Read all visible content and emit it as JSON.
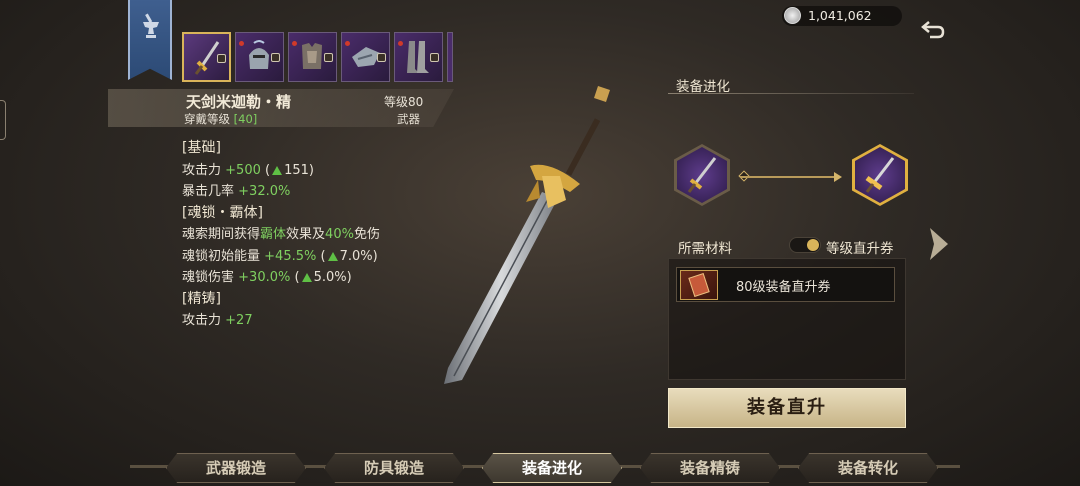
{
  "currency": {
    "icon": "silver-coin-icon",
    "value": "1,041,062"
  },
  "item": {
    "name": "天剑米迦勒・精",
    "level": "等级80",
    "wear_label": "穿戴等级",
    "wear_level": "[40]",
    "type": "武器"
  },
  "stats": {
    "base_header": "[基础]",
    "attack_label": "攻击力",
    "attack_value": "+500",
    "attack_open": "(",
    "attack_up": "151",
    "attack_close": ")",
    "crit_label": "暴击几率",
    "crit_value": "+32.0%",
    "soul_header": "[魂锁・霸体]",
    "soul_desc_a": "魂索期间获得",
    "soul_desc_b": "霸体",
    "soul_desc_c": "效果及",
    "soul_desc_d": "40%",
    "soul_desc_e": "免伤",
    "energy_label": "魂锁初始能量",
    "energy_value": "+45.5%",
    "energy_open": "(",
    "energy_up": "7.0%",
    "energy_close": ")",
    "dmg_label": "魂锁伤害",
    "dmg_value": "+30.0%",
    "dmg_open": "(",
    "dmg_up": "5.0%",
    "dmg_close": ")",
    "refine_header": "[精铸]",
    "refine_label": "攻击力",
    "refine_value": "+27"
  },
  "evolution": {
    "title": "装备进化",
    "materials_label": "所需材料",
    "toggle_label": "等级直升券",
    "material_item": "80级装备直升券",
    "upgrade_button": "装备直升"
  },
  "tabs": [
    {
      "label": "武器锻造"
    },
    {
      "label": "防具锻造"
    },
    {
      "label": "装备进化"
    },
    {
      "label": "装备精铸"
    },
    {
      "label": "装备转化"
    }
  ],
  "active_tab": "装备进化",
  "colors": {
    "stat_green": "#7fd060",
    "gold_border": "#d9b45a",
    "slot_purple": "#4a2c6a"
  }
}
